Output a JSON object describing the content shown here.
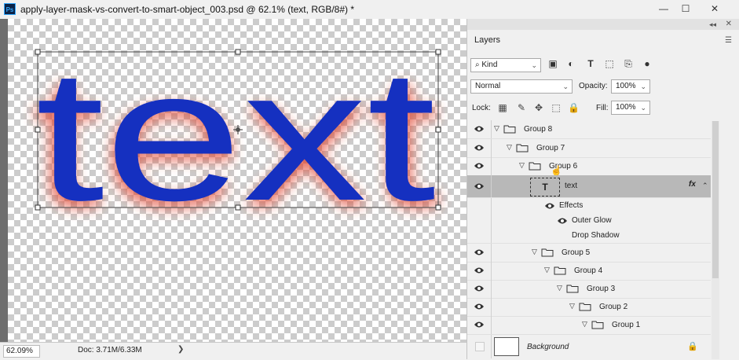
{
  "window": {
    "title": "apply-layer-mask-vs-convert-to-smart-object_003.psd @ 62.1% (text, RGB/8#) *",
    "app_icon": "Ps",
    "controls": {
      "minimize": "—",
      "maximize": "☐",
      "close": "✕"
    }
  },
  "canvas": {
    "text_content": "text",
    "text_color": "#1530c0",
    "glow_color": "#e0402a"
  },
  "status": {
    "zoom": "62.09%",
    "doc": "Doc: 3.71M/6.33M",
    "arrow": "❯"
  },
  "layers_panel": {
    "tab": "Layers",
    "filter": {
      "label": "Kind"
    },
    "blend_mode": "Normal",
    "opacity_label": "Opacity:",
    "opacity_value": "100%",
    "lock_label": "Lock:",
    "fill_label": "Fill:",
    "fill_value": "100%",
    "layers": [
      {
        "name": "Group 8",
        "type": "group",
        "visible": true,
        "indent": 0
      },
      {
        "name": "Group 7",
        "type": "group",
        "visible": true,
        "indent": 1
      },
      {
        "name": "Group 6",
        "type": "group",
        "visible": true,
        "indent": 2
      },
      {
        "name": "text",
        "type": "text",
        "visible": true,
        "indent": 3,
        "selected": true,
        "fx": "fx"
      },
      {
        "name": "Effects",
        "type": "effects",
        "visible": true,
        "indent": 4
      },
      {
        "name": "Outer Glow",
        "type": "effect",
        "visible": true,
        "indent": 5
      },
      {
        "name": "Drop Shadow",
        "type": "effect",
        "visible": false,
        "indent": 5
      },
      {
        "name": "Group 5",
        "type": "group",
        "visible": true,
        "indent": 3
      },
      {
        "name": "Group 4",
        "type": "group",
        "visible": true,
        "indent": 4
      },
      {
        "name": "Group 3",
        "type": "group",
        "visible": true,
        "indent": 5
      },
      {
        "name": "Group 2",
        "type": "group",
        "visible": true,
        "indent": 6
      },
      {
        "name": "Group 1",
        "type": "group",
        "visible": true,
        "indent": 7
      }
    ],
    "background_layer": "Background"
  }
}
